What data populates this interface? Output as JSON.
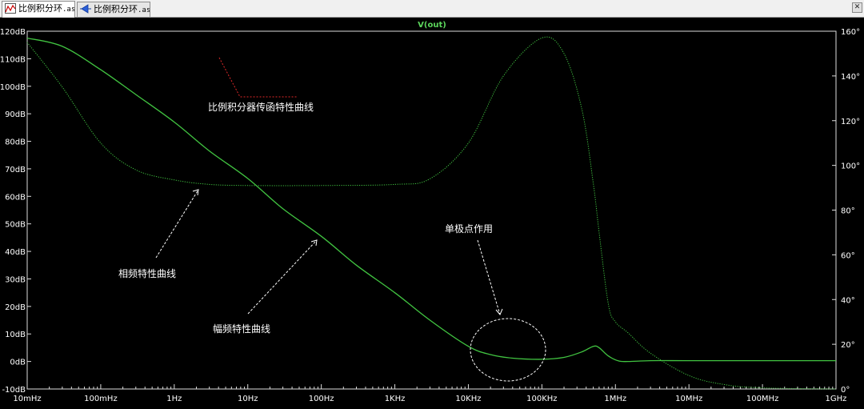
{
  "tabs": [
    {
      "name": "比例积分环",
      "ext": ".asc",
      "active": true
    },
    {
      "name": "比例积分环",
      "ext": ".asc",
      "active": false
    }
  ],
  "colors": {
    "background": "#000000",
    "curve": "#41c441",
    "frame": "#dcdcdc",
    "annotation_arrow_white": "#ffffff",
    "annotation_arrow_red": "#e02828"
  },
  "chart_data": {
    "type": "line",
    "title": "V(out)",
    "x_scale": "log",
    "x_range_hz": [
      0.01,
      1000000000
    ],
    "x_ticks": [
      {
        "value": 0.01,
        "label": "10mHz"
      },
      {
        "value": 0.1,
        "label": "100mHz"
      },
      {
        "value": 1,
        "label": "1Hz"
      },
      {
        "value": 10,
        "label": "10Hz"
      },
      {
        "value": 100,
        "label": "100Hz"
      },
      {
        "value": 1000,
        "label": "1KHz"
      },
      {
        "value": 10000,
        "label": "10KHz"
      },
      {
        "value": 100000,
        "label": "100KHz"
      },
      {
        "value": 1000000,
        "label": "1MHz"
      },
      {
        "value": 10000000,
        "label": "10MHz"
      },
      {
        "value": 100000000,
        "label": "100MHz"
      },
      {
        "value": 1000000000,
        "label": "1GHz"
      }
    ],
    "y_left": {
      "unit": "dB",
      "range": [
        -10,
        120
      ],
      "ticks": [
        "120dB",
        "110dB",
        "100dB",
        "90dB",
        "80dB",
        "70dB",
        "60dB",
        "50dB",
        "40dB",
        "30dB",
        "20dB",
        "10dB",
        "0dB",
        "-10dB"
      ]
    },
    "y_right": {
      "unit": "°",
      "range": [
        0,
        160
      ],
      "ticks": [
        "160°",
        "140°",
        "120°",
        "100°",
        "80°",
        "60°",
        "40°",
        "20°",
        "0°"
      ]
    },
    "grid": false,
    "series": [
      {
        "axis": "left",
        "style": "solid",
        "points": [
          [
            0.01,
            117.5
          ],
          [
            0.03,
            114.5
          ],
          [
            0.1,
            106
          ],
          [
            0.3,
            97
          ],
          [
            1,
            87
          ],
          [
            3,
            76.5
          ],
          [
            10,
            66.5
          ],
          [
            30,
            55.5
          ],
          [
            100,
            45.5
          ],
          [
            300,
            35
          ],
          [
            1000,
            25
          ],
          [
            3000,
            15
          ],
          [
            10000,
            5.5
          ],
          [
            20000,
            2.5
          ],
          [
            40000,
            1.2
          ],
          [
            100000,
            0.8
          ],
          [
            200000,
            1.5
          ],
          [
            350000,
            3.5
          ],
          [
            500000,
            5.5
          ],
          [
            600000,
            5
          ],
          [
            800000,
            2
          ],
          [
            1100000,
            0.2
          ],
          [
            1500000,
            0
          ],
          [
            3000000,
            0.3
          ],
          [
            10000000,
            0.3
          ],
          [
            100000000,
            0.3
          ],
          [
            1000000000,
            0.3
          ]
        ]
      },
      {
        "axis": "right",
        "style": "dotted",
        "points": [
          [
            0.01,
            155
          ],
          [
            0.03,
            135
          ],
          [
            0.1,
            110
          ],
          [
            0.3,
            98
          ],
          [
            1,
            93.5
          ],
          [
            3,
            91.5
          ],
          [
            10,
            91
          ],
          [
            100,
            91
          ],
          [
            1000,
            91.5
          ],
          [
            3000,
            94
          ],
          [
            10000,
            110
          ],
          [
            30000,
            140
          ],
          [
            100000,
            157
          ],
          [
            200000,
            150
          ],
          [
            350000,
            125
          ],
          [
            500000,
            92
          ],
          [
            600000,
            70
          ],
          [
            800000,
            38
          ],
          [
            1000000,
            30
          ],
          [
            1500000,
            25
          ],
          [
            3000000,
            16
          ],
          [
            10000000,
            6
          ],
          [
            30000000,
            2
          ],
          [
            100000000,
            0.5
          ],
          [
            1000000000,
            0
          ]
        ]
      }
    ],
    "annotations": [
      {
        "text": "比例积分器传函特性曲线"
      },
      {
        "text": "相频特性曲线"
      },
      {
        "text": "幅频特性曲线"
      },
      {
        "text": "单极点作用"
      }
    ]
  }
}
